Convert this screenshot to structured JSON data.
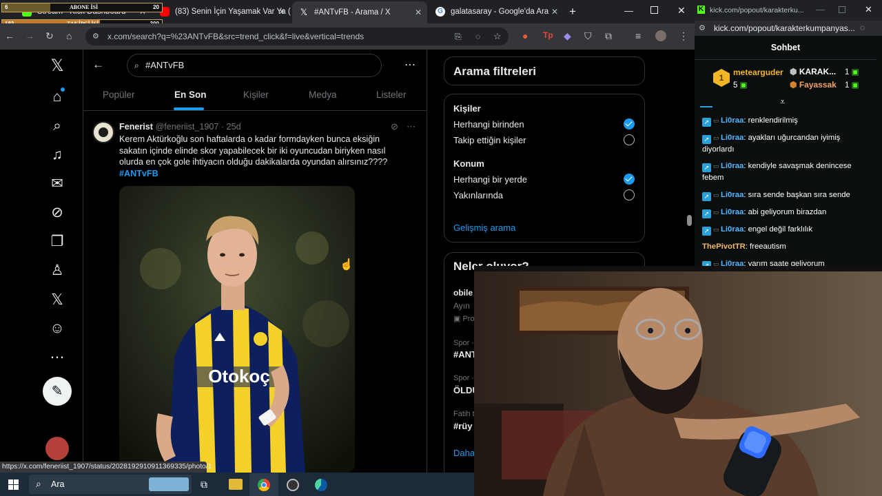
{
  "overlay": {
    "subscriber_goal": {
      "label": "ABONE İSİ",
      "current": "6",
      "target": "20"
    },
    "follower_goal": {
      "label": "TAKİPÇİ İSİ",
      "current": "183",
      "target": "300"
    },
    "follower_progress_pct": 61
  },
  "browser": {
    "tabs": [
      {
        "title": "Stream - Kick Dashboard"
      },
      {
        "title": "(83) Senin İçin Yaşamak Var Ya ("
      },
      {
        "title": "#ANTvFB - Arama / X"
      },
      {
        "title": "galatasaray - Google'da Ara"
      }
    ],
    "url": "x.com/search?q=%23ANTvFB&src=trend_click&f=live&vertical=trends",
    "status_url": "https://x.com/feneriist_1907/status/2028192910911369335/photo/1"
  },
  "x": {
    "search_query": "#ANTvFB",
    "filter_tabs": [
      "Popüler",
      "En Son",
      "Kişiler",
      "Medya",
      "Listeler"
    ],
    "tweet": {
      "name": "Fenerist",
      "handle": "@feneriist_1907",
      "time": "· 25d",
      "text": "Kerem Aktürkoğlu son haftalarda o kadar formdayken bunca eksiğin sakatın içinde elinde skor yapabilecek bir iki oyuncudan biriyken nasıl olurda en çok gole ihtiyacın olduğu dakikalarda oyundan alırsınız????",
      "hashtag": "#ANTvFB",
      "jersey_sponsor": "Otokoç"
    },
    "filters": {
      "title": "Arama filtreleri",
      "people_title": "Kişiler",
      "people_options": [
        "Herhangi birinden",
        "Takip ettiğin kişiler"
      ],
      "location_title": "Konum",
      "location_options": [
        "Herhangi bir yerde",
        "Yakınlarında"
      ],
      "advanced": "Gelişmiş arama"
    },
    "trends": {
      "title": "Neler oluyor?",
      "items": [
        {
          "context": "obile",
          "sub": "Ayın",
          "promo": "Pro"
        },
        {
          "context": "Spor ·",
          "name": "#ANT"
        },
        {
          "context": "Spor ·",
          "name": "ÖLDÜ"
        },
        {
          "context": "Fatih t",
          "name": "#rüy"
        }
      ],
      "more": "Daha"
    }
  },
  "kick": {
    "url": "kick.com/popout/karakterku...",
    "url_full": "kick.com/popout/karakterkumpanyas...",
    "chat_title": "Sohbet",
    "top": [
      {
        "rank": "1",
        "name": "metearguder",
        "count": "5"
      },
      {
        "name": "KARAK...",
        "count": "1"
      },
      {
        "name": "Fayassak",
        "count": "1"
      }
    ],
    "messages": [
      {
        "user": "Li0raa",
        "text": ": renklendirilmiş"
      },
      {
        "user": "Li0raa",
        "text": ": ayakları uğurcandan iyimiş diyorlardı"
      },
      {
        "user": "Li0raa",
        "text": ": kendiyle savaşmak denincese febem"
      },
      {
        "user": "Li0raa",
        "text": ": sıra sende başkan sıra sende"
      },
      {
        "user": "Li0raa",
        "text": ": abi geliyorum birazdan"
      },
      {
        "user": "Li0raa",
        "text": ": engel değil farklılık"
      },
      {
        "user": "ThePivotTR",
        "text": ": freeautism"
      },
      {
        "user": "Li0raa",
        "text": ": yarım saate geliyorum"
      }
    ]
  },
  "taskbar": {
    "search": "Ara"
  }
}
